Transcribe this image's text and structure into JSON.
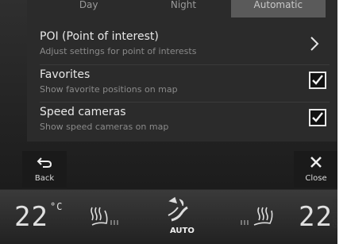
{
  "tabs": [
    {
      "label": "Day",
      "selected": false
    },
    {
      "label": "Night",
      "selected": false
    },
    {
      "label": "Automatic",
      "selected": true
    }
  ],
  "rows": [
    {
      "title": "POI (Point of interest)",
      "subtitle": "Adjust settings for point of interests",
      "control": "chevron"
    },
    {
      "title": "Favorites",
      "subtitle": "Show favorite positions on map",
      "control": "checkbox",
      "checked": true
    },
    {
      "title": "Speed cameras",
      "subtitle": "Show speed cameras on map",
      "control": "checkbox",
      "checked": true
    }
  ],
  "buttons": {
    "back": "Back",
    "close": "Close"
  },
  "climate": {
    "left_temp": "22",
    "unit": "°C",
    "right_temp": "22",
    "auto_label": "AUTO",
    "left_seat_heat_icon": "seat-heat-icon",
    "right_seat_heat_icon": "seat-heat-icon",
    "fan_icon": "fan-airflow-icon"
  },
  "figure_id": "G054008"
}
